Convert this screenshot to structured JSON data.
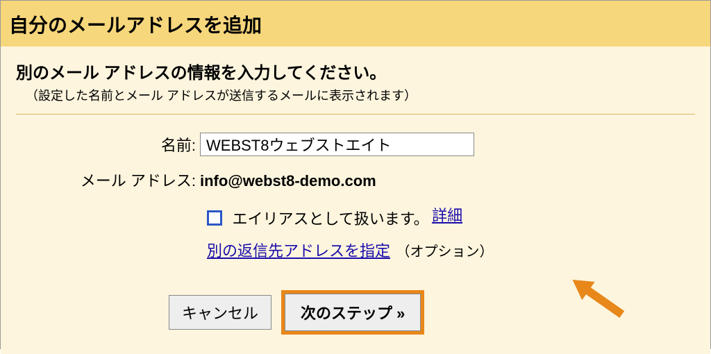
{
  "header": {
    "title": "自分のメールアドレスを追加"
  },
  "section": {
    "heading": "別のメール アドレスの情報を入力してください。",
    "subheading": "（設定した名前とメール アドレスが送信するメールに表示されます）"
  },
  "form": {
    "name_label": "名前:",
    "name_value": "WEBST8ウェブストエイト",
    "email_label": "メール アドレス:",
    "email_value": "info@webst8-demo.com",
    "alias_label": "エイリアスとして扱います。",
    "alias_detail_link": "詳細",
    "reply_to_link": "別の返信先アドレスを指定",
    "reply_to_option": "（オプション）"
  },
  "buttons": {
    "cancel": "キャンセル",
    "next": "次のステップ »"
  }
}
